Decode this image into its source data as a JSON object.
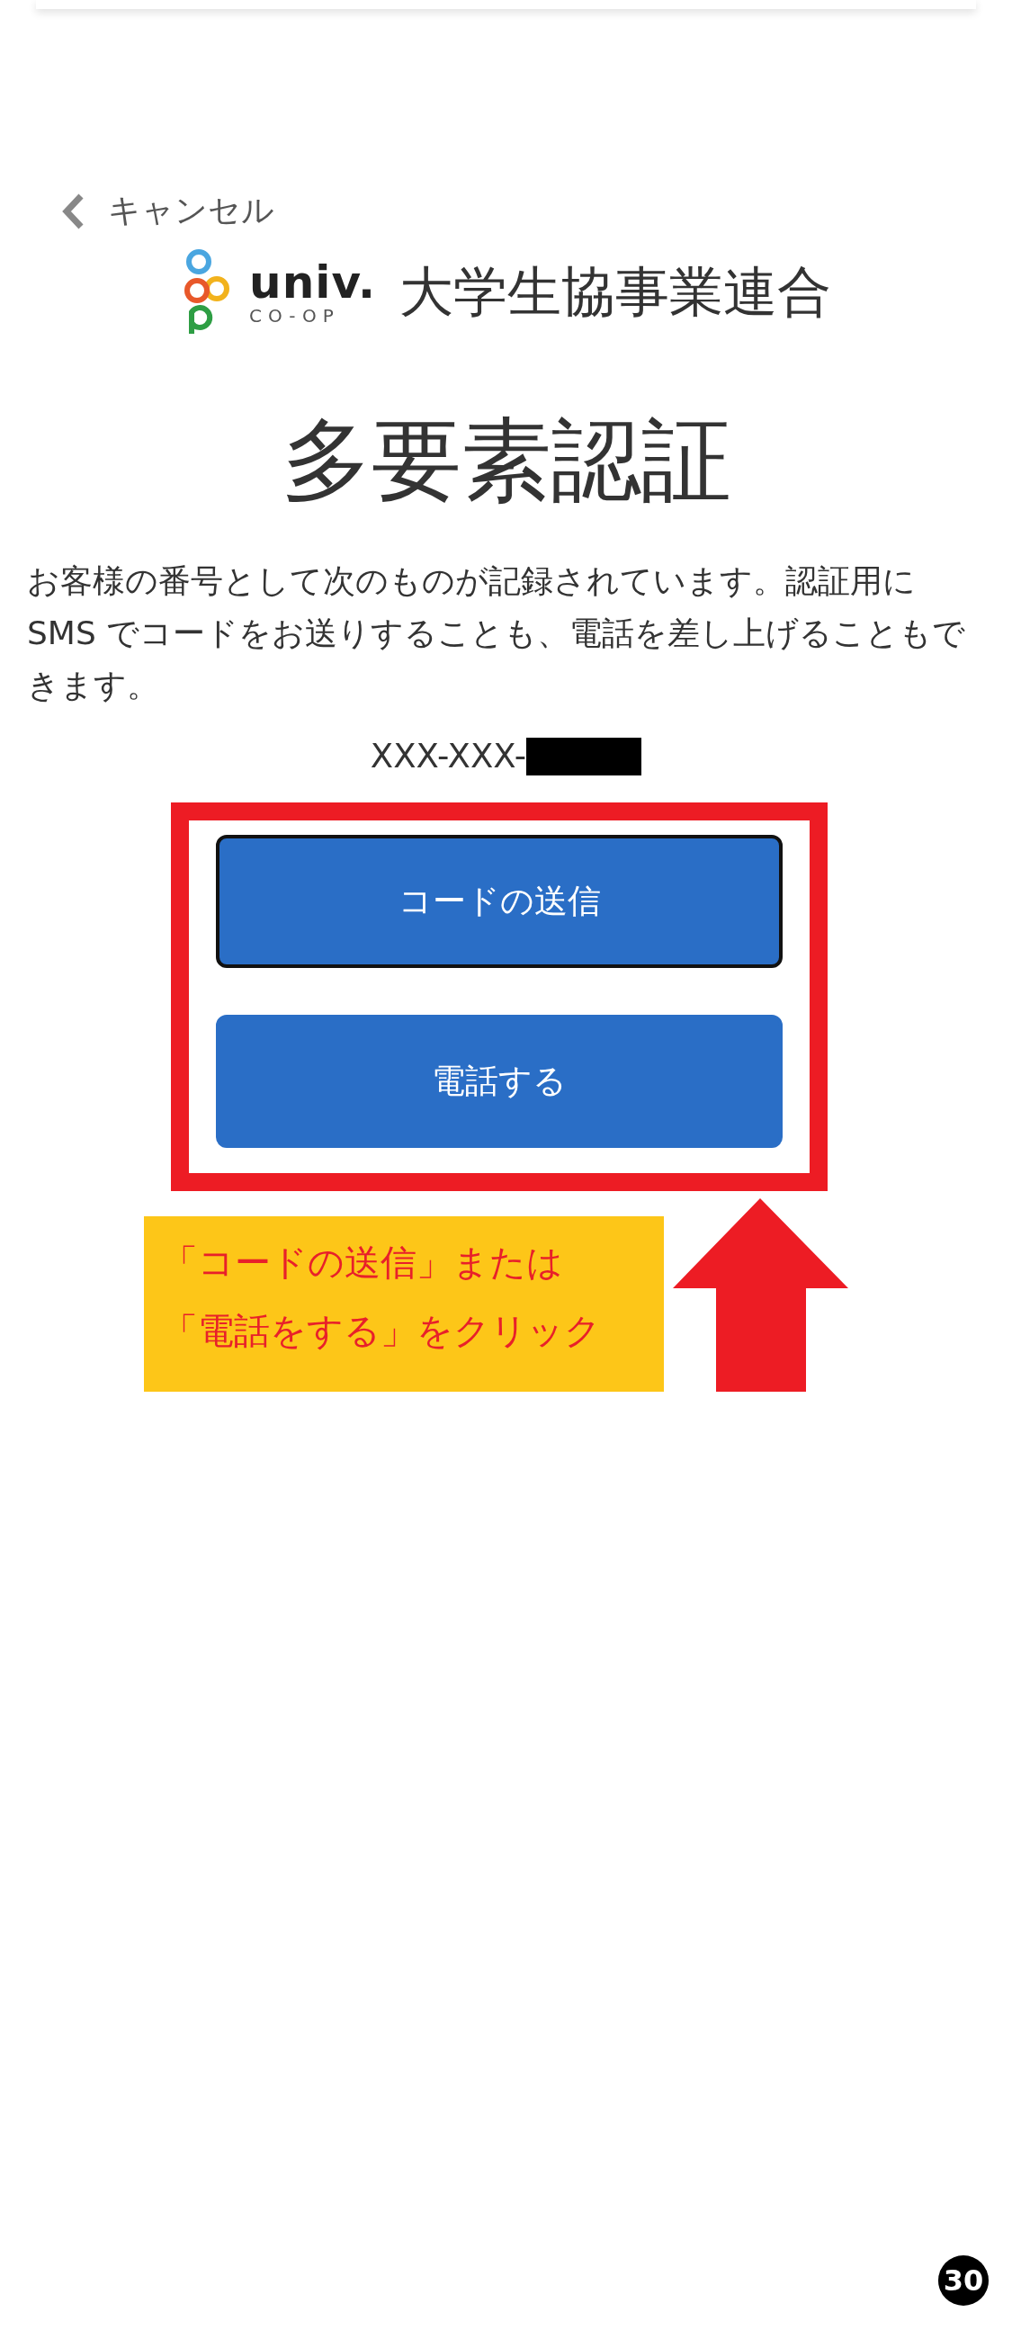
{
  "header": {
    "cancel_label": "キャンセル"
  },
  "logo": {
    "wordmark": "univ.",
    "subtitle": "CO-OP",
    "name": "大学生協事業連合"
  },
  "title": "多要素認証",
  "description": "お客様の番号として次のものが記録されています。認証用に SMS でコードをお送りすることも、電話を差し上げることもできます。",
  "phone_number": "XXX-XXX-",
  "buttons": [
    {
      "label": "コードの送信",
      "focused": true
    },
    {
      "label": "電話する",
      "focused": false
    }
  ],
  "annotation": {
    "lines": [
      "「コードの送信」または",
      "「電話をする」をクリック"
    ]
  },
  "page_badge": "30"
}
